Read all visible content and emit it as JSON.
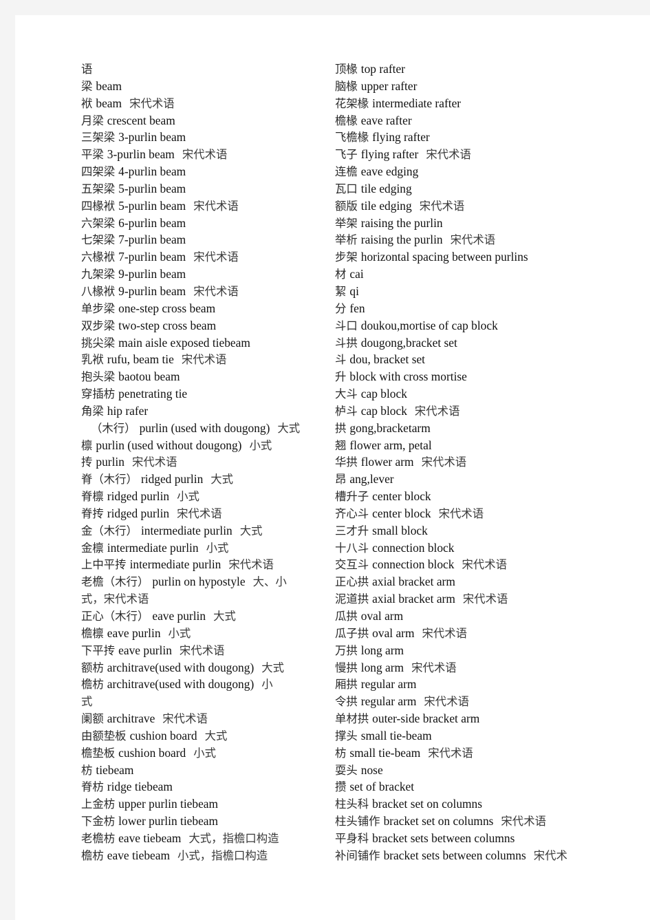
{
  "page": {
    "background_color": "#f4f4f4",
    "paper_color": "#ffffff",
    "text_color": "#1a1a1a",
    "document_type": "bilingual-glossary",
    "title_fragment": "语"
  },
  "columns": {
    "left": [
      {
        "term": "语",
        "gloss": "",
        "note": ""
      },
      {
        "term": "梁",
        "gloss": "beam",
        "note": ""
      },
      {
        "term": "袱",
        "gloss": "beam",
        "note": "宋代术语"
      },
      {
        "term": "月梁",
        "gloss": "crescent beam",
        "note": ""
      },
      {
        "term": "三架梁",
        "gloss": "3-purlin beam",
        "note": ""
      },
      {
        "term": "平梁",
        "gloss": "3-purlin beam",
        "note": "宋代术语"
      },
      {
        "term": "四架梁",
        "gloss": "4-purlin beam",
        "note": ""
      },
      {
        "term": "五架梁",
        "gloss": "5-purlin beam",
        "note": ""
      },
      {
        "term": "四椽袱",
        "gloss": "5-purlin beam",
        "note": "宋代术语"
      },
      {
        "term": "六架梁",
        "gloss": "6-purlin beam",
        "note": ""
      },
      {
        "term": "七架梁",
        "gloss": "7-purlin beam",
        "note": ""
      },
      {
        "term": "六椽袱",
        "gloss": "7-purlin beam",
        "note": "宋代术语"
      },
      {
        "term": "九架梁",
        "gloss": "9-purlin beam",
        "note": ""
      },
      {
        "term": "八椽袱",
        "gloss": "9-purlin beam",
        "note": "宋代术语"
      },
      {
        "term": "单步梁",
        "gloss": "one-step cross beam",
        "note": ""
      },
      {
        "term": "双步梁",
        "gloss": "two-step cross beam",
        "note": ""
      },
      {
        "term": "挑尖梁",
        "gloss": "main aisle exposed tiebeam",
        "note": ""
      },
      {
        "term": "乳袱",
        "gloss": "rufu, beam tie",
        "note": "宋代术语"
      },
      {
        "term": "抱头梁",
        "gloss": "baotou beam",
        "note": ""
      },
      {
        "term": "穿插枋",
        "gloss": "penetrating tie",
        "note": ""
      },
      {
        "term": "角梁",
        "gloss": "hip rafer",
        "note": ""
      },
      {
        "term": "（木行）",
        "gloss": "purlin (used with dougong)",
        "note": "大式",
        "indent": true
      },
      {
        "term": "檩",
        "gloss": "purlin (used without dougong)",
        "note": "小式"
      },
      {
        "term": "抟",
        "gloss": "purlin",
        "note": "宋代术语"
      },
      {
        "term": "脊（木行）",
        "gloss": "ridged purlin",
        "note": "大式"
      },
      {
        "term": "脊檩",
        "gloss": "ridged purlin",
        "note": "小式"
      },
      {
        "term": "脊抟",
        "gloss": "ridged purlin",
        "note": "宋代术语"
      },
      {
        "term": "金（木行）",
        "gloss": "intermediate purlin",
        "note": "大式"
      },
      {
        "term": "金檩",
        "gloss": "intermediate purlin",
        "note": "小式"
      },
      {
        "term": "上中平抟",
        "gloss": "intermediate purlin",
        "note": "宋代术语"
      },
      {
        "term": "老檐（木行）",
        "gloss": "purlin on hypostyle",
        "note": "大、小"
      },
      {
        "term": "",
        "gloss": "",
        "note": "式，宋代术语",
        "continuation": true
      },
      {
        "term": "正心（木行）",
        "gloss": "eave purlin",
        "note": "大式"
      },
      {
        "term": "檐檩",
        "gloss": "eave purlin",
        "note": "小式"
      },
      {
        "term": "下平抟",
        "gloss": "eave purlin",
        "note": "宋代术语"
      },
      {
        "term": "额枋",
        "gloss": "architrave(used with dougong)",
        "note": "大式"
      },
      {
        "term": "檐枋",
        "gloss": "architrave(used with    dougong)",
        "note": "小"
      },
      {
        "term": "",
        "gloss": "",
        "note": "式",
        "continuation": true
      },
      {
        "term": "阑额",
        "gloss": "architrave",
        "note": "宋代术语"
      },
      {
        "term": "由额垫板",
        "gloss": "cushion board",
        "note": "大式"
      },
      {
        "term": "檐垫板",
        "gloss": "cushion board",
        "note": "小式"
      },
      {
        "term": "枋",
        "gloss": "tiebeam",
        "note": ""
      },
      {
        "term": "脊枋",
        "gloss": "ridge tiebeam",
        "note": ""
      },
      {
        "term": "上金枋",
        "gloss": "upper purlin tiebeam",
        "note": ""
      },
      {
        "term": "下金枋",
        "gloss": "lower purlin tiebeam",
        "note": ""
      },
      {
        "term": "老檐枋",
        "gloss": "eave tiebeam",
        "note": "大式，指檐口构造"
      },
      {
        "term": "檐枋",
        "gloss": "eave tiebeam",
        "note": "小式，指檐口构造"
      }
    ],
    "right": [
      {
        "term": "顶椽",
        "gloss": "top rafter",
        "note": ""
      },
      {
        "term": "脑椽",
        "gloss": "upper rafter",
        "note": ""
      },
      {
        "term": "花架椽",
        "gloss": "intermediate rafter",
        "note": ""
      },
      {
        "term": "檐椽",
        "gloss": "eave rafter",
        "note": ""
      },
      {
        "term": "飞檐椽",
        "gloss": "flying rafter",
        "note": ""
      },
      {
        "term": "飞子",
        "gloss": "flying rafter",
        "note": "宋代术语"
      },
      {
        "term": "连檐",
        "gloss": "eave edging",
        "note": ""
      },
      {
        "term": "瓦口",
        "gloss": "tile edging",
        "note": ""
      },
      {
        "term": "额版",
        "gloss": "tile edging",
        "note": "宋代术语"
      },
      {
        "term": "举架",
        "gloss": "raising the purlin",
        "note": ""
      },
      {
        "term": "举析",
        "gloss": "raising the purlin",
        "note": "宋代术语"
      },
      {
        "term": "步架",
        "gloss": "horizontal spacing between purlins",
        "note": ""
      },
      {
        "term": "材",
        "gloss": "cai",
        "note": ""
      },
      {
        "term": "絜",
        "gloss": "qi",
        "note": ""
      },
      {
        "term": "分",
        "gloss": "fen",
        "note": ""
      },
      {
        "term": "斗口",
        "gloss": "doukou,mortise of cap block",
        "note": ""
      },
      {
        "term": "斗拱",
        "gloss": "dougong,bracket set",
        "note": ""
      },
      {
        "term": "斗",
        "gloss": "dou, bracket set",
        "note": ""
      },
      {
        "term": "升",
        "gloss": "block with cross mortise",
        "note": ""
      },
      {
        "term": "大斗",
        "gloss": "cap block",
        "note": ""
      },
      {
        "term": "栌斗",
        "gloss": "cap block",
        "note": "宋代术语"
      },
      {
        "term": "拱",
        "gloss": "gong,bracketarm",
        "note": ""
      },
      {
        "term": "翘",
        "gloss": "flower arm, petal",
        "note": ""
      },
      {
        "term": "华拱",
        "gloss": "flower arm",
        "note": "宋代术语"
      },
      {
        "term": "昂",
        "gloss": "ang,lever",
        "note": ""
      },
      {
        "term": "槽升子",
        "gloss": "center block",
        "note": ""
      },
      {
        "term": "齐心斗",
        "gloss": "center block",
        "note": "宋代术语"
      },
      {
        "term": "三才升",
        "gloss": "small block",
        "note": ""
      },
      {
        "term": "十八斗",
        "gloss": "connection block",
        "note": ""
      },
      {
        "term": "交互斗",
        "gloss": "connection block",
        "note": "宋代术语"
      },
      {
        "term": "正心拱",
        "gloss": "axial bracket arm",
        "note": ""
      },
      {
        "term": "泥道拱",
        "gloss": "axial bracket arm",
        "note": "宋代术语"
      },
      {
        "term": "瓜拱",
        "gloss": "oval arm",
        "note": ""
      },
      {
        "term": "瓜子拱",
        "gloss": "oval arm",
        "note": "宋代术语"
      },
      {
        "term": "万拱",
        "gloss": "long arm",
        "note": ""
      },
      {
        "term": "慢拱",
        "gloss": "long arm",
        "note": "宋代术语"
      },
      {
        "term": "厢拱",
        "gloss": "regular arm",
        "note": ""
      },
      {
        "term": "令拱",
        "gloss": "regular arm",
        "note": "宋代术语"
      },
      {
        "term": "单材拱",
        "gloss": "outer-side bracket arm",
        "note": ""
      },
      {
        "term": "撑头",
        "gloss": "small tie-beam",
        "note": ""
      },
      {
        "term": "枋",
        "gloss": "small tie-beam",
        "note": "宋代术语"
      },
      {
        "term": "耍头",
        "gloss": "nose",
        "note": ""
      },
      {
        "term": "攒",
        "gloss": "set of bracket",
        "note": ""
      },
      {
        "term": "柱头科",
        "gloss": "bracket set on columns",
        "note": ""
      },
      {
        "term": "柱头铺作",
        "gloss": "bracket set on columns",
        "note": "宋代术语"
      },
      {
        "term": "平身科",
        "gloss": "bracket sets between columns",
        "note": ""
      },
      {
        "term": "补间铺作",
        "gloss": "bracket sets between columns",
        "note": "宋代术"
      }
    ]
  }
}
